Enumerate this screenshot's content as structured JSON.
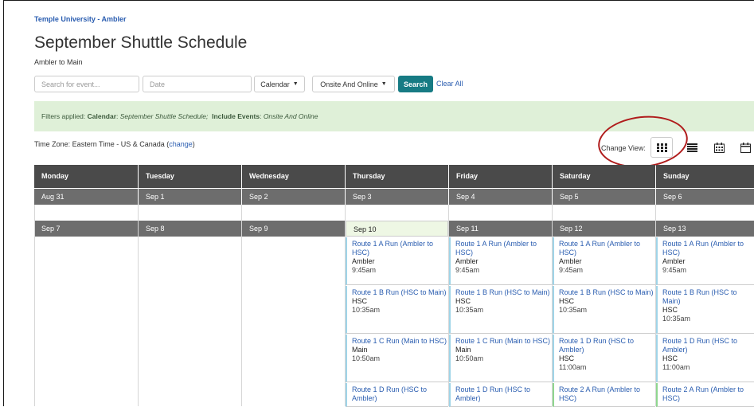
{
  "breadcrumb": "Temple University - Ambler",
  "page_title": "September Shuttle Schedule",
  "subtitle": "Ambler to Main",
  "search": {
    "placeholder": "Search for event...",
    "date_placeholder": "Date"
  },
  "dropdowns": {
    "calendar": "Calendar",
    "onsite": "Onsite And Online"
  },
  "buttons": {
    "search": "Search",
    "clear_all": "Clear All"
  },
  "filters": {
    "prefix": "Filters applied:",
    "calendar_label": "Calendar",
    "calendar_value": "September Shuttle Schedule;",
    "events_label": "Include Events",
    "events_value": "Onsite And Online"
  },
  "timezone": {
    "text": "Time Zone: Eastern Time - US & Canada (",
    "link": "change",
    "close": ")"
  },
  "change_view": {
    "label": "Change View:",
    "icons": [
      "grid-view-icon",
      "list-view-icon",
      "calendar-month-icon",
      "calendar-week-icon"
    ]
  },
  "weekdays": [
    "Monday",
    "Tuesday",
    "Wednesday",
    "Thursday",
    "Friday",
    "Saturday",
    "Sunday"
  ],
  "week1_dates": [
    "Aug 31",
    "Sep 1",
    "Sep 2",
    "Sep 3",
    "Sep 4",
    "Sep 5",
    "Sep 6"
  ],
  "week2_dates": [
    "Sep 7",
    "Sep 8",
    "Sep 9",
    "Sep 10",
    "Sep 11",
    "Sep 12",
    "Sep 13"
  ],
  "events": {
    "thu": [
      {
        "title": "Route 1 A Run (Ambler to HSC)",
        "loc": "Ambler",
        "time": "9:45am"
      },
      {
        "title": "Route 1 B Run (HSC to Main)",
        "loc": "HSC",
        "time": "10:35am"
      },
      {
        "title": "Route 1 C Run (Main to HSC)",
        "loc": "Main",
        "time": "10:50am"
      },
      {
        "title": "Route 1 D Run (HSC to Ambler)",
        "loc": "",
        "time": ""
      }
    ],
    "fri": [
      {
        "title": "Route 1 A Run (Ambler to HSC)",
        "loc": "Ambler",
        "time": "9:45am"
      },
      {
        "title": "Route 1 B Run (HSC to Main)",
        "loc": "HSC",
        "time": "10:35am"
      },
      {
        "title": "Route 1 C Run (Main to HSC)",
        "loc": "Main",
        "time": "10:50am"
      },
      {
        "title": "Route 1 D Run (HSC to Ambler)",
        "loc": "",
        "time": ""
      }
    ],
    "sat": [
      {
        "title": "Route 1 A Run (Ambler to HSC)",
        "loc": "Ambler",
        "time": "9:45am"
      },
      {
        "title": "Route 1 B Run (HSC to Main)",
        "loc": "HSC",
        "time": "10:35am"
      },
      {
        "title": "Route 1 D Run (HSC to Ambler)",
        "loc": "HSC",
        "time": "11:00am"
      },
      {
        "title": "Route 2 A Run (Ambler to HSC)",
        "loc": "",
        "time": ""
      }
    ],
    "sun": [
      {
        "title": "Route 1 A Run (Ambler to HSC)",
        "loc": "Ambler",
        "time": "9:45am"
      },
      {
        "title": "Route 1 B Run (HSC to Main)",
        "loc": "HSC",
        "time": "10:35am"
      },
      {
        "title": "Route 1 D Run (HSC to Ambler)",
        "loc": "HSC",
        "time": "11:00am"
      },
      {
        "title": "Route 2 A Run (Ambler to HSC)",
        "loc": "",
        "time": ""
      }
    ]
  }
}
